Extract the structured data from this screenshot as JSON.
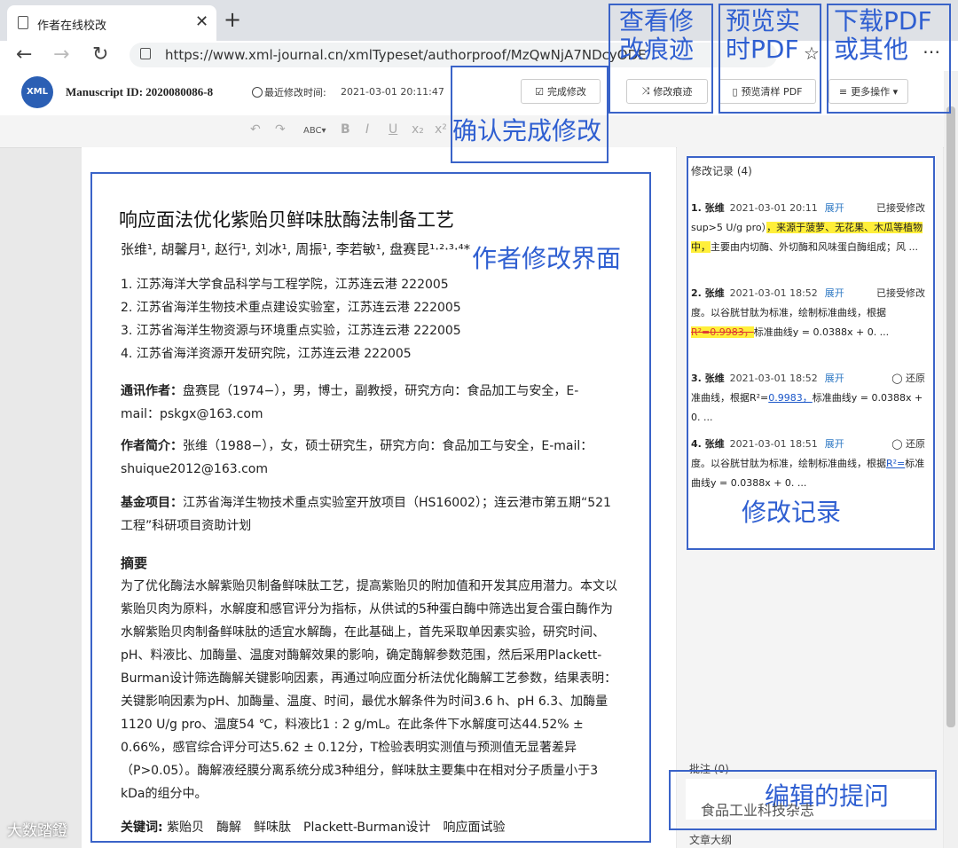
{
  "browser": {
    "tab_title": "作者在线校改",
    "new_tab": "+",
    "close": "✕",
    "back": "←",
    "forward": "→",
    "reload": "↻",
    "url": "https://www.xml-journal.cn/xmlTypeset/authorproof/MzQwNjA7NDcyODE",
    "star": "☆",
    "menu": "⋯"
  },
  "header": {
    "logo_text": "XML",
    "manuscript_id": "Manuscript ID: 2020080086-8",
    "modified_label": "最近修改时间:",
    "modified_time": "2021-03-01 20:11:47",
    "buttons": {
      "finish": "完成修改",
      "track": "修改痕迹",
      "preview": "预览清样 PDF",
      "more": "更多操作 ▾"
    }
  },
  "toolbar": {
    "undo": "↶",
    "redo": "↷",
    "spell": "ABC▾",
    "bold": "B",
    "italic": "I",
    "underline": "U",
    "subscript": "x₂",
    "superscript": "x²"
  },
  "document": {
    "title": "响应面法优化紫贻贝鲜味肽酶法制备工艺",
    "authors": "张维¹, 胡馨月¹, 赵行¹, 刘冰¹, 周振¹, 李若敏¹, 盘赛昆¹·²·³·⁴*",
    "affiliations": [
      "1. 江苏海洋大学食品科学与工程学院，江苏连云港 222005",
      "2. 江苏省海洋生物技术重点建设实验室，江苏连云港 222005",
      "3. 江苏省海洋生物资源与环境重点实验，江苏连云港 222005",
      "4. 江苏省海洋资源开发研究院，江苏连云港 222005"
    ],
    "corresponding_label": "通讯作者：",
    "corresponding_text": "盘赛昆（1974−），男，博士，副教授，研究方向：食品加工与安全，E-mail：pskgx@163.com",
    "bio_label": "作者简介：",
    "bio_text": "张维（1988−），女，硕士研究生，研究方向：食品加工与安全，E-mail：shuique2012@163.com",
    "fund_label": "基金项目：",
    "fund_text": "江苏省海洋生物技术重点实验室开放项目（HS16002）；连云港市第五期“521工程”科研项目资助计划",
    "abstract_head": "摘要",
    "abstract_text": "为了优化酶法水解紫贻贝制备鲜味肽工艺，提高紫贻贝的附加值和开发其应用潜力。本文以紫贻贝肉为原料，水解度和感官评分为指标，从供试的5种蛋白酶中筛选出复合蛋白酶作为水解紫贻贝肉制备鲜味肽的适宜水解酶，在此基础上，首先采取单因素实验，研究时间、pH、料液比、加酶量、温度对酶解效果的影响，确定酶解参数范围，然后采用Plackett-Burman设计筛选酶解关键影响因素，再通过响应面分析法优化酶解工艺参数，结果表明：关键影响因素为pH、加酶量、温度、时间，最优水解条件为时间3.6 h、pH 6.3、加酶量1120 U/g pro、温度54 ℃，料液比1 : 2 g/mL。在此条件下水解度可达44.52% ± 0.66%，感官综合评分可达5.62 ± 0.12分，T检验表明实测值与预测值无显著差异（P>0.05）。酶解液经膜分离系统分成3种组分，鲜味肽主要集中在相对分子质量小于3 kDa的组分中。",
    "keywords_label": "关键词:",
    "keywords": "紫贻贝　酶解　鲜味肽　Plackett-Burman设计　响应面试验"
  },
  "records": {
    "head": "修改记录 (4)",
    "items": [
      {
        "num": "1. 张维",
        "time": "2021-03-01 20:11",
        "expand": "展开",
        "status": "已接受修改",
        "pre": "sup>5 U/g pro）",
        "hl": "，来源于菠萝、无花果、木瓜等植物中，",
        "post": "主要由内切酶、外切酶和风味蛋白酶组成；风 ..."
      },
      {
        "num": "2. 张维",
        "time": "2021-03-01 18:52",
        "expand": "展开",
        "status": "已接受修改",
        "pre": "度。以谷胱甘肽为标准，绘制标准曲线，根据",
        "del": "R²=0.9983，",
        "post": "标准曲线y = 0.0388x + 0. ..."
      },
      {
        "num": "3. 张维",
        "time": "2021-03-01 18:52",
        "expand": "展开",
        "status": "◯ 还原",
        "pre": "准曲线，根据R²=",
        "ins": "0.9983，",
        "post": "标准曲线y = 0.0388x + 0. ..."
      },
      {
        "num": "4. 张维",
        "time": "2021-03-01 18:51",
        "expand": "展开",
        "status": "◯ 还原",
        "pre": "度。以谷胱甘肽为标准，绘制标准曲线，根据",
        "ins": "R²=",
        "post": "标准曲线y = 0.0388x + 0. ..."
      }
    ],
    "note_label": "批注 (0)",
    "outline_label": "文章大纲"
  },
  "annotations": {
    "view_track": "查看修改痕迹",
    "preview_pdf": "预览实时PDF",
    "download_pdf": "下载PDF或其他",
    "confirm": "确认完成修改",
    "author_ui": "作者修改界面",
    "records": "修改记录",
    "editor_note": "编辑的提问"
  },
  "watermark": "大数踏鐙",
  "watermark2": "食品工业科技杂志"
}
